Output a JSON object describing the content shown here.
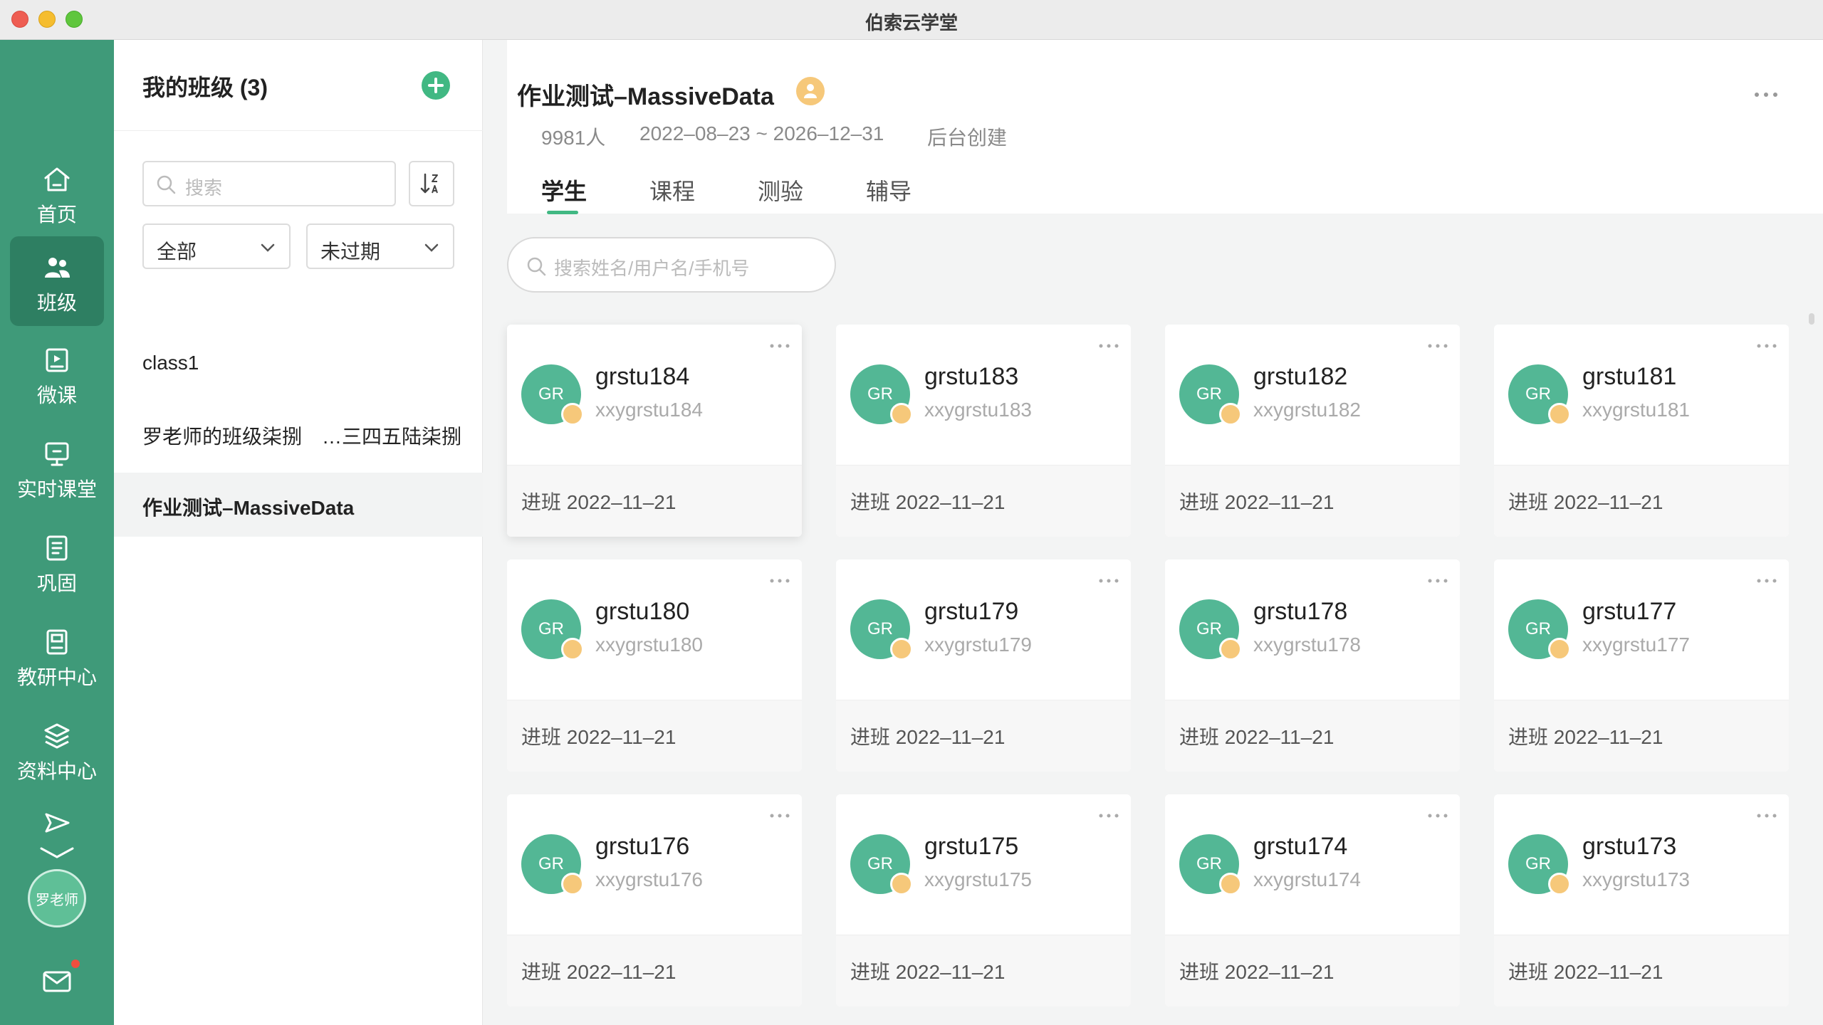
{
  "window": {
    "title": "伯索云学堂"
  },
  "nav": {
    "items": [
      {
        "label": "首页",
        "icon": "home-icon"
      },
      {
        "label": "班级",
        "icon": "users-icon",
        "active": true
      },
      {
        "label": "微课",
        "icon": "video-lesson-icon"
      },
      {
        "label": "实时课堂",
        "icon": "live-class-icon"
      },
      {
        "label": "巩固",
        "icon": "notebook-icon"
      },
      {
        "label": "教研中心",
        "icon": "book-icon"
      },
      {
        "label": "资料中心",
        "icon": "layers-icon"
      }
    ],
    "user": {
      "avatar_text": "罗老师"
    }
  },
  "classes": {
    "title": "我的班级 (3)",
    "search_placeholder": "搜索",
    "filter_scope": "全部",
    "filter_status": "未过期",
    "list": [
      {
        "name": "class1"
      },
      {
        "name": "罗老师的班级柒捌　…三四五陆柒捌"
      },
      {
        "name": "作业测试–MassiveData",
        "active": true
      }
    ]
  },
  "detail": {
    "title": "作业测试–MassiveData",
    "count": "9981人",
    "date_range": "2022–08–23 ~ 2026–12–31",
    "source": "后台创建",
    "tabs": [
      "学生",
      "课程",
      "测验",
      "辅导"
    ],
    "active_tab": 0,
    "student_search_placeholder": "搜索姓名/用户名/手机号"
  },
  "students": [
    {
      "avatar": "GR",
      "name": "grstu184",
      "login": "xxygrstu184",
      "join": "进班  2022–11–21"
    },
    {
      "avatar": "GR",
      "name": "grstu183",
      "login": "xxygrstu183",
      "join": "进班  2022–11–21"
    },
    {
      "avatar": "GR",
      "name": "grstu182",
      "login": "xxygrstu182",
      "join": "进班  2022–11–21"
    },
    {
      "avatar": "GR",
      "name": "grstu181",
      "login": "xxygrstu181",
      "join": "进班  2022–11–21"
    },
    {
      "avatar": "GR",
      "name": "grstu180",
      "login": "xxygrstu180",
      "join": "进班  2022–11–21"
    },
    {
      "avatar": "GR",
      "name": "grstu179",
      "login": "xxygrstu179",
      "join": "进班  2022–11–21"
    },
    {
      "avatar": "GR",
      "name": "grstu178",
      "login": "xxygrstu178",
      "join": "进班  2022–11–21"
    },
    {
      "avatar": "GR",
      "name": "grstu177",
      "login": "xxygrstu177",
      "join": "进班  2022–11–21"
    },
    {
      "avatar": "GR",
      "name": "grstu176",
      "login": "xxygrstu176",
      "join": "进班  2022–11–21"
    },
    {
      "avatar": "GR",
      "name": "grstu175",
      "login": "xxygrstu175",
      "join": "进班  2022–11–21"
    },
    {
      "avatar": "GR",
      "name": "grstu174",
      "login": "xxygrstu174",
      "join": "进班  2022–11–21"
    },
    {
      "avatar": "GR",
      "name": "grstu173",
      "login": "xxygrstu173",
      "join": "进班  2022–11–21"
    }
  ],
  "colors": {
    "brand": "#3f9a79",
    "accent": "#41b883",
    "avatar": "#53b795",
    "badge": "#f6c87a"
  }
}
